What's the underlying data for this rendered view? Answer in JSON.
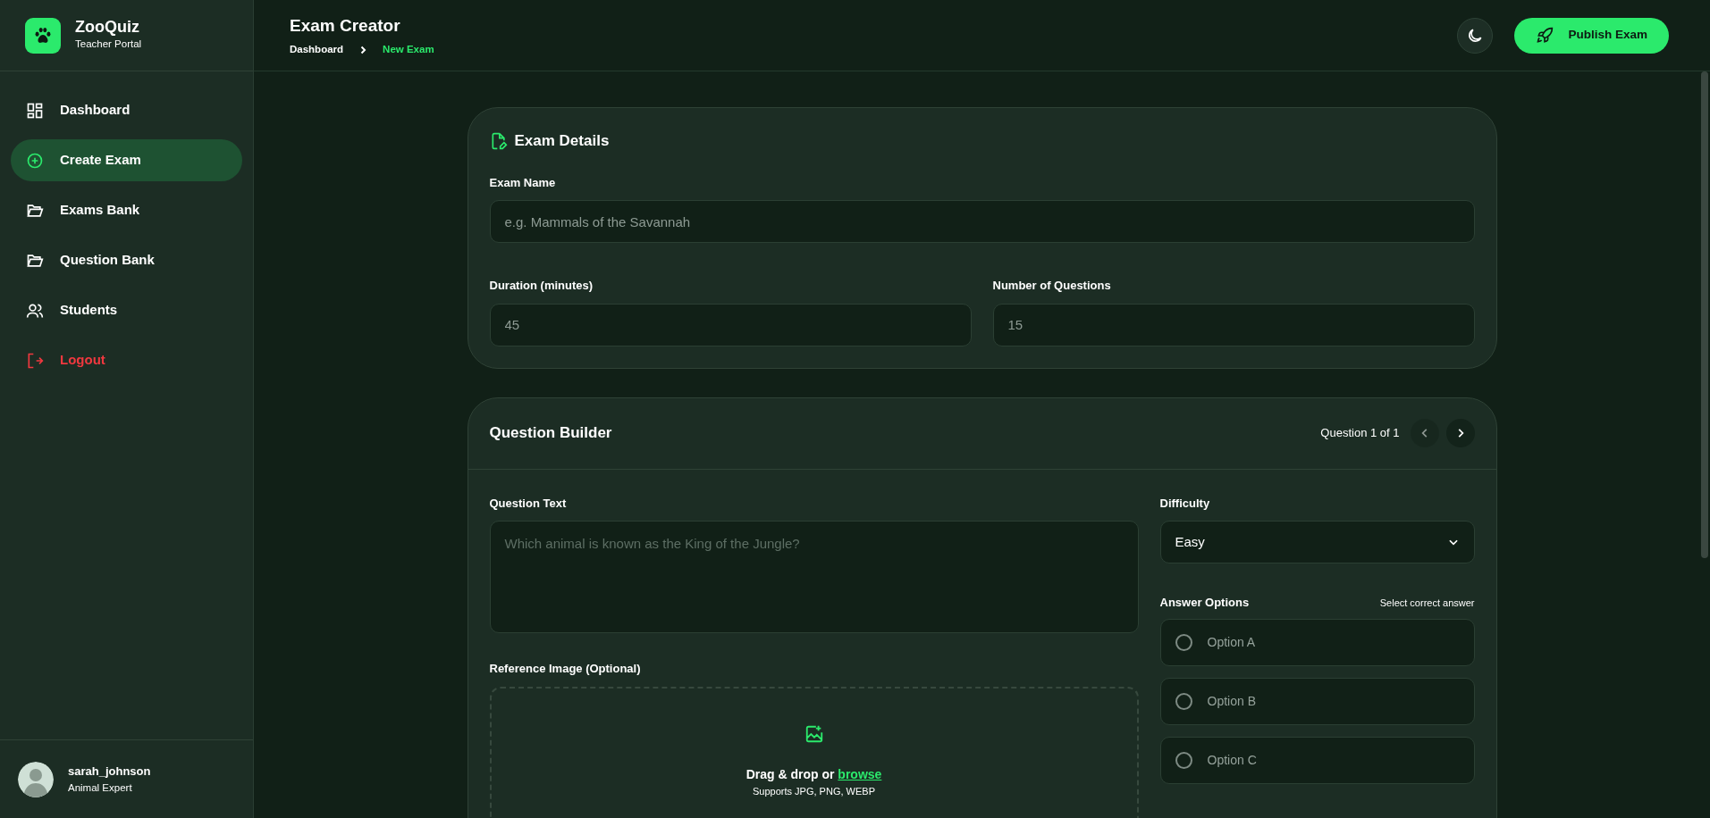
{
  "brand": {
    "name": "ZooQuiz",
    "subtitle": "Teacher Portal"
  },
  "nav": [
    {
      "label": "Dashboard",
      "kind": "link",
      "selected": false
    },
    {
      "label": "Create Exam",
      "kind": "link",
      "selected": true
    },
    {
      "label": "Exams Bank",
      "kind": "link",
      "selected": false
    },
    {
      "label": "Question Bank",
      "kind": "link",
      "selected": false
    },
    {
      "label": "Students",
      "kind": "link",
      "selected": false
    },
    {
      "label": "Logout",
      "kind": "danger",
      "selected": false
    }
  ],
  "user": {
    "name": "sarah_johnson",
    "role": "Animal Expert"
  },
  "header": {
    "title": "Exam Creator",
    "breadcrumb": [
      {
        "label": "Dashboard",
        "selected": false
      },
      {
        "label": "New Exam",
        "selected": true
      }
    ],
    "publish_button": "Publish Exam"
  },
  "exam_details": {
    "title": "Exam Details",
    "fields": [
      {
        "label": "Exam Name",
        "placeholder": "e.g. Mammals of the Savannah"
      },
      {
        "label": "Duration (minutes)",
        "placeholder": "45"
      },
      {
        "label": "Number of Questions",
        "placeholder": "15"
      }
    ]
  },
  "question_builder": {
    "title": "Question Builder",
    "counter": "Question 1 of 1",
    "prev_disabled": true,
    "next_disabled": false,
    "question_label": "Question Text",
    "question_placeholder": "Which animal is known as the King of the Jungle?",
    "image_label": "Reference Image (Optional)",
    "drop_text": "Drag & drop or",
    "browse_link": "browse",
    "supports": "Supports JPG, PNG, WEBP",
    "difficulty_label": "Difficulty",
    "difficulty": "Easy",
    "answers_label": "Answer Options",
    "answers_hint": "Select correct answer",
    "options": [
      {
        "label": "Option A",
        "selected": false
      },
      {
        "label": "Option B",
        "selected": false
      },
      {
        "label": "Option C",
        "selected": false
      }
    ]
  }
}
